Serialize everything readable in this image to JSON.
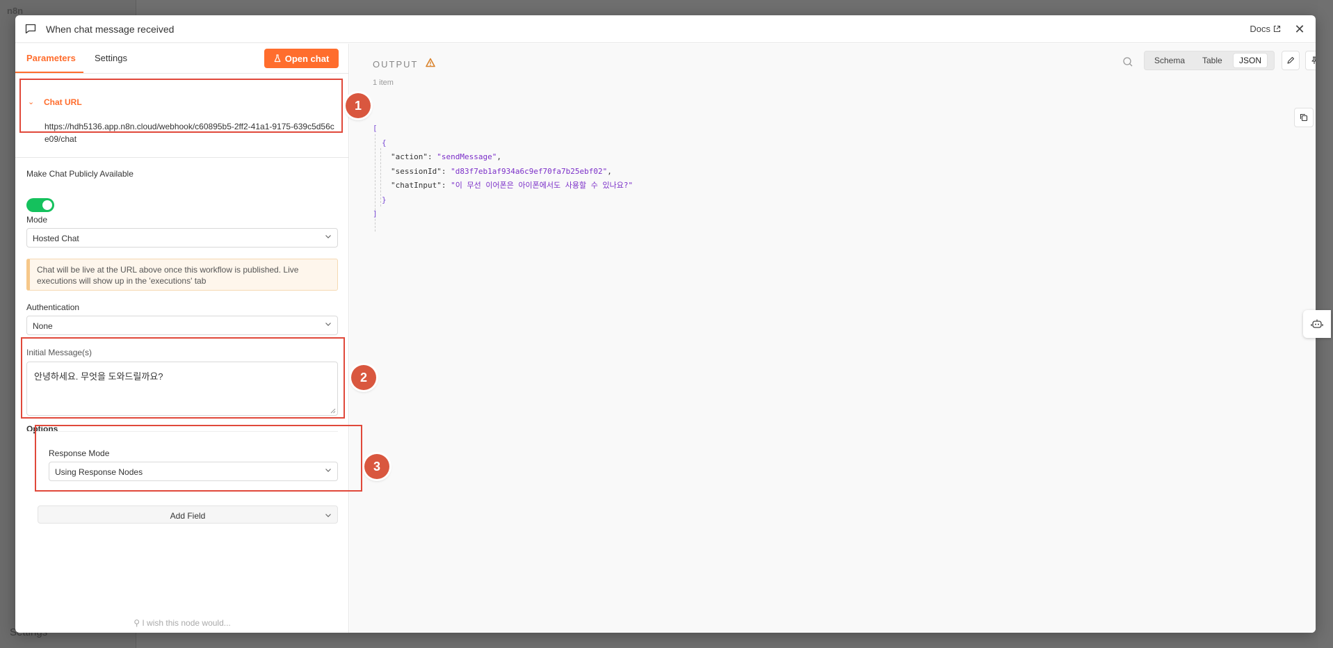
{
  "background": {
    "logo_text": "n8n",
    "settings_label": "Settings"
  },
  "modal": {
    "title": "When chat message received",
    "docs_label": "Docs"
  },
  "left_panel": {
    "tabs": [
      "Parameters",
      "Settings"
    ],
    "open_chat_label": "Open chat",
    "chat_url": {
      "label": "Chat URL",
      "value": "https://hdh5136.app.n8n.cloud/webhook/c60895b5-2ff2-41a1-9175-639c5d56ce09/chat"
    },
    "make_public": {
      "label": "Make Chat Publicly Available",
      "enabled": true
    },
    "mode": {
      "label": "Mode",
      "value": "Hosted Chat"
    },
    "notice": "Chat will be live at the URL above once this workflow is published. Live executions will show up in the 'executions' tab",
    "authentication": {
      "label": "Authentication",
      "value": "None"
    },
    "initial_messages": {
      "label": "Initial Message(s)",
      "value": "안녕하세요. 무엇을 도와드릴까요?"
    },
    "options": {
      "label": "Options",
      "response_mode_label": "Response Mode",
      "response_mode_value": "Using Response Nodes",
      "add_field_label": "Add Field"
    },
    "wish_text": "I wish this node would..."
  },
  "annotations": [
    "1",
    "2",
    "3"
  ],
  "output_panel": {
    "title": "OUTPUT",
    "item_count": "1 item",
    "views": [
      "Schema",
      "Table",
      "JSON"
    ],
    "active_view": "JSON",
    "json": {
      "open_bracket": "[",
      "open_brace": "{",
      "fields": [
        {
          "key": "\"action\"",
          "value": "\"sendMessage\"",
          "sep": ","
        },
        {
          "key": "\"sessionId\"",
          "value": "\"d83f7eb1af934a6c9ef70fa7b25ebf02\"",
          "sep": ","
        },
        {
          "key": "\"chatInput\"",
          "value": "\"이 무선 이어폰은 아이폰에서도 사용할 수 있나요?\"",
          "sep": ""
        }
      ],
      "close_brace": "}",
      "close_bracket": "]"
    }
  },
  "colors": {
    "accent": "#ff6d2d",
    "annotation": "#e0483a",
    "toggle_on": "#15c15d"
  }
}
